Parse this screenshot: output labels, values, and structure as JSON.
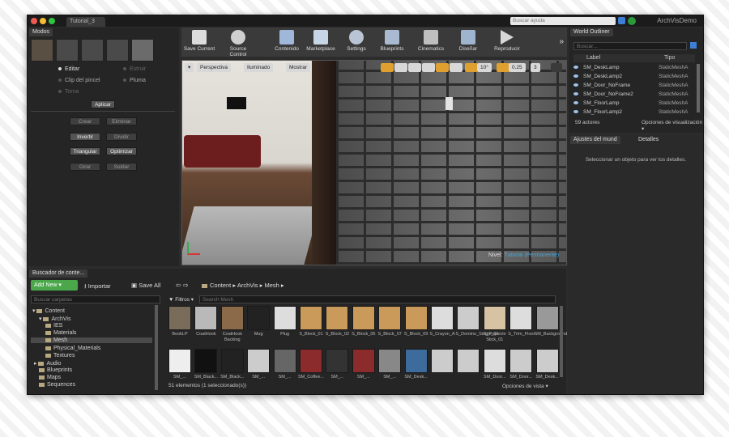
{
  "window": {
    "tab_title": "Tutorial_3",
    "help_search_placeholder": "Buscar ayuda",
    "project_name": "ArchVisDemo"
  },
  "modes": {
    "tab": "Modos",
    "radio": [
      "Editar",
      "Estruir",
      "Clip del pincel",
      "Pluma",
      "Toma"
    ],
    "apply": "Aplicar",
    "buttons": [
      "Crear",
      "Eliminar",
      "Invertir",
      "Dividir",
      "Triangular",
      "Optimizar",
      "Girar",
      "Soldar"
    ]
  },
  "toolbar": {
    "items": [
      "Save Current",
      "Source Control",
      "Contenido",
      "Marketplace",
      "Settings",
      "Blueprints",
      "Cinematics",
      "Diseñar",
      "Reproducir"
    ]
  },
  "viewport": {
    "perspective": "Perspectiva",
    "lit": "Iluminado",
    "show": "Mostrar",
    "snap_angle": "10°",
    "scale_snap": "0.25",
    "cam_speed": "3",
    "level_label": "Nivel:",
    "level_name": "Tutorial (Permanente)"
  },
  "outliner": {
    "tab": "World Outliner",
    "search_placeholder": "Buscar...",
    "col_label": "Label",
    "col_type": "Tipo",
    "rows": [
      {
        "label": "SM_DeskLamp",
        "type": "StaticMeshA"
      },
      {
        "label": "SM_DeskLamp2",
        "type": "StaticMeshA"
      },
      {
        "label": "SM_Door_NoFrame",
        "type": "StaticMeshA"
      },
      {
        "label": "SM_Door_NoFrame2",
        "type": "StaticMeshA"
      },
      {
        "label": "SM_FloorLamp",
        "type": "StaticMeshA"
      },
      {
        "label": "SM_FloorLamp2",
        "type": "StaticMeshA"
      }
    ],
    "actor_count": "59 actores",
    "view_options": "Opciones de visualización"
  },
  "details": {
    "tab_world": "Ajustes del mund",
    "tab_details": "Detalles",
    "hint": "Seleccionar un objeto para ver los detalles."
  },
  "content_browser": {
    "tab": "Buscador de conte...",
    "add_new": "Add New",
    "import": "Importar",
    "save_all": "Save All",
    "path": [
      "Content",
      "ArchVis",
      "Mesh"
    ],
    "filters": "Filtros",
    "search_placeholder": "Search Mesh",
    "folder_search_placeholder": "Buscar carpetas",
    "tree": [
      "Content",
      "ArchVis",
      "IES",
      "Materials",
      "Mesh",
      "Physical_Materials",
      "Textures",
      "Audio",
      "Blueprints",
      "Maps",
      "Sequences"
    ],
    "assets_row1": [
      "BookLP",
      "CoatHook",
      "CoatHook Backing",
      "Mug",
      "Plug",
      "S_Block_01",
      "S_Block_02",
      "S_Block_05",
      "S_Block_07",
      "S_Block_09",
      "S_Crayon_A",
      "S_Domino_Single_01",
      "S_Popsicle Stick_01",
      "S_Trim_Floor",
      "SM_Background"
    ],
    "assets_row2": [
      "SM_...",
      "SM_Black...",
      "SM_Black...",
      "SM_...",
      "SM_...",
      "SM_Coffee...",
      "SM_...",
      "SM_...",
      "SM_...",
      "SM_Desk...",
      "",
      "",
      "SM_Door...",
      "SM_Door...",
      "SM_Desk..."
    ],
    "status": "51 elementos (1 seleccionado(s))",
    "view_options": "Opciones de vista"
  },
  "colors": {
    "accent_green": "#4aa84a",
    "link_blue": "#3f8fd4"
  }
}
